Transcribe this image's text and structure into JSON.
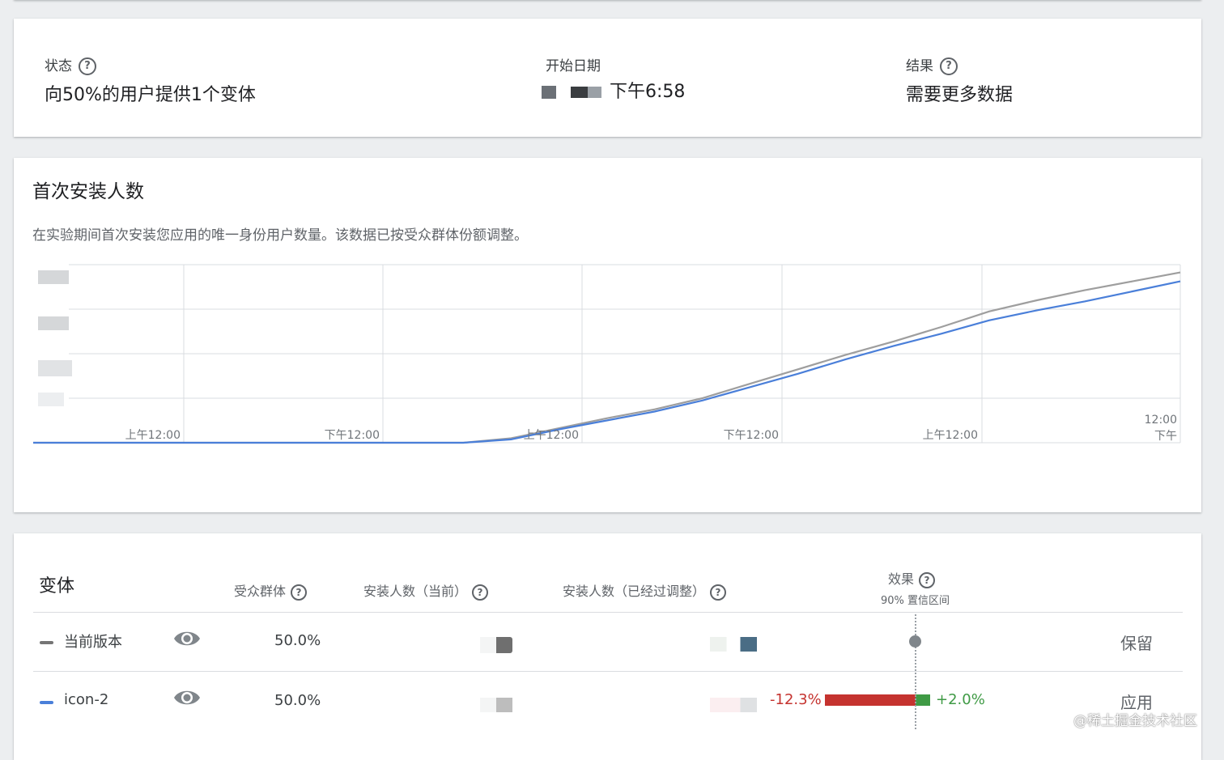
{
  "status": {
    "label": "状态",
    "value": "向50%的用户提供1个变体"
  },
  "start_date": {
    "label": "开始日期",
    "value_suffix": "下午6:58"
  },
  "result": {
    "label": "结果",
    "value": "需要更多数据"
  },
  "chart_section": {
    "title": "首次安装人数",
    "description": "在实验期间首次安装您应用的唯一身份用户数量。该数据已按受众群体份额调整。"
  },
  "chart_data": {
    "type": "line",
    "title": "",
    "xlabel": "",
    "ylabel": "",
    "x_tick_labels": [
      "上午12:00",
      "下午12:00",
      "上午12:00",
      "下午12:00",
      "上午12:00",
      "12:00 下午"
    ],
    "x": [
      0,
      1,
      2,
      3,
      4,
      5,
      6,
      7,
      8,
      9,
      10,
      11,
      12,
      13,
      14,
      15,
      16,
      17,
      18,
      19,
      20,
      21,
      22,
      23,
      24
    ],
    "series": [
      {
        "color": "#9e9e9e",
        "values": [
          0,
          0,
          0,
          0,
          0,
          0,
          0,
          0,
          0,
          0,
          0.04,
          0.13,
          0.22,
          0.3,
          0.4,
          0.53,
          0.66,
          0.79,
          0.91,
          1.04,
          1.18,
          1.28,
          1.37,
          1.45,
          1.53
        ]
      },
      {
        "color": "#4a7fd9",
        "values": [
          0,
          0,
          0,
          0,
          0,
          0,
          0,
          0,
          0,
          0,
          0.03,
          0.12,
          0.2,
          0.28,
          0.38,
          0.5,
          0.62,
          0.75,
          0.87,
          0.98,
          1.1,
          1.19,
          1.27,
          1.36,
          1.45
        ]
      }
    ],
    "grid": true,
    "ylim": [
      0,
      1.6
    ]
  },
  "variants_table": {
    "headers": {
      "variant": "变体",
      "audience": "受众群体",
      "installs_current": "安装人数（当前）",
      "installs_adjusted": "安装人数（已经过调整）",
      "effect": "效果",
      "effect_sub": "90% 置信区间"
    },
    "rows": [
      {
        "name": "当前版本",
        "color": "#757575",
        "audience": "50.0%",
        "action": "保留"
      },
      {
        "name": "icon-2",
        "color": "#4a7fd9",
        "audience": "50.0%",
        "action": "应用",
        "ci_low": "-12.3%",
        "ci_high": "+2.0%"
      }
    ]
  },
  "watermark": "@稀土掘金技术社区"
}
